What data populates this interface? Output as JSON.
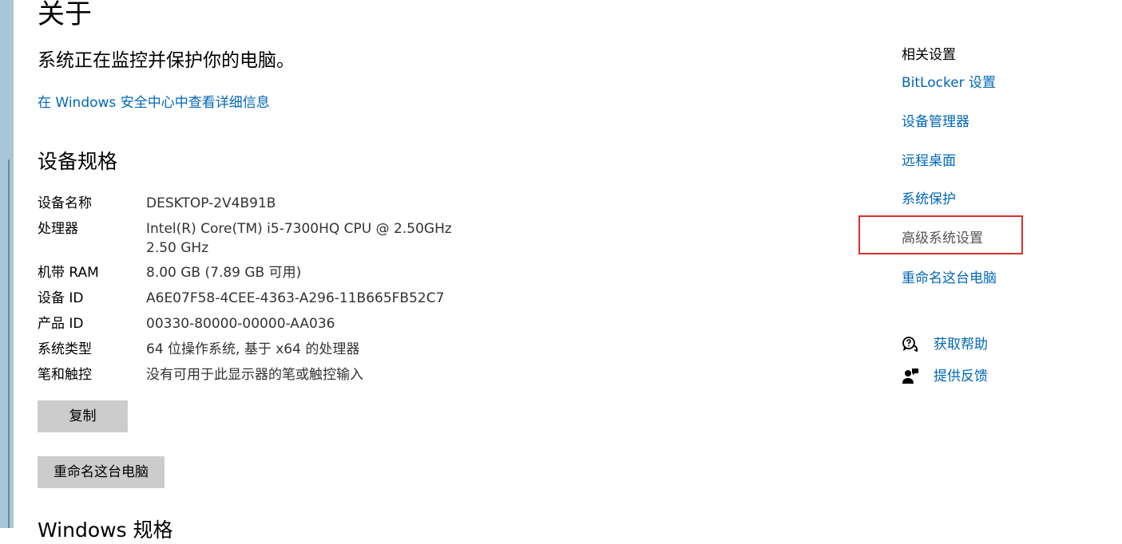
{
  "page": {
    "title": "关于",
    "protection_text": "系统正在监控并保护你的电脑。",
    "security_link": "在 Windows 安全中心中查看详细信息",
    "specs_heading": "设备规格",
    "partial_heading": "Windows 规格"
  },
  "specs": [
    {
      "label": "设备名称",
      "value": "DESKTOP-2V4B91B"
    },
    {
      "label": "处理器",
      "value": "Intel(R) Core(TM) i5-7300HQ CPU @ 2.50GHz   2.50 GHz"
    },
    {
      "label": "机带 RAM",
      "value": "8.00 GB (7.89 GB 可用)"
    },
    {
      "label": "设备 ID",
      "value": "A6E07F58-4CEE-4363-A296-11B665FB52C7"
    },
    {
      "label": "产品 ID",
      "value": "00330-80000-00000-AA036"
    },
    {
      "label": "系统类型",
      "value": "64 位操作系统, 基于 x64 的处理器"
    },
    {
      "label": "笔和触控",
      "value": "没有可用于此显示器的笔或触控输入"
    }
  ],
  "buttons": {
    "copy": "复制",
    "rename": "重命名这台电脑"
  },
  "related": {
    "title": "相关设置",
    "links": [
      {
        "label": "BitLocker 设置"
      },
      {
        "label": "设备管理器"
      },
      {
        "label": "远程桌面"
      },
      {
        "label": "系统保护"
      },
      {
        "label": "高级系统设置"
      },
      {
        "label": "重命名这台电脑"
      }
    ]
  },
  "help": {
    "get_help": "获取帮助",
    "feedback": "提供反馈",
    "get_help_icon": "chat-help-icon",
    "feedback_icon": "person-feedback-icon"
  },
  "colors": {
    "link": "#0067b8",
    "highlight_border": "#d9302c",
    "button_bg": "#cccccc"
  }
}
